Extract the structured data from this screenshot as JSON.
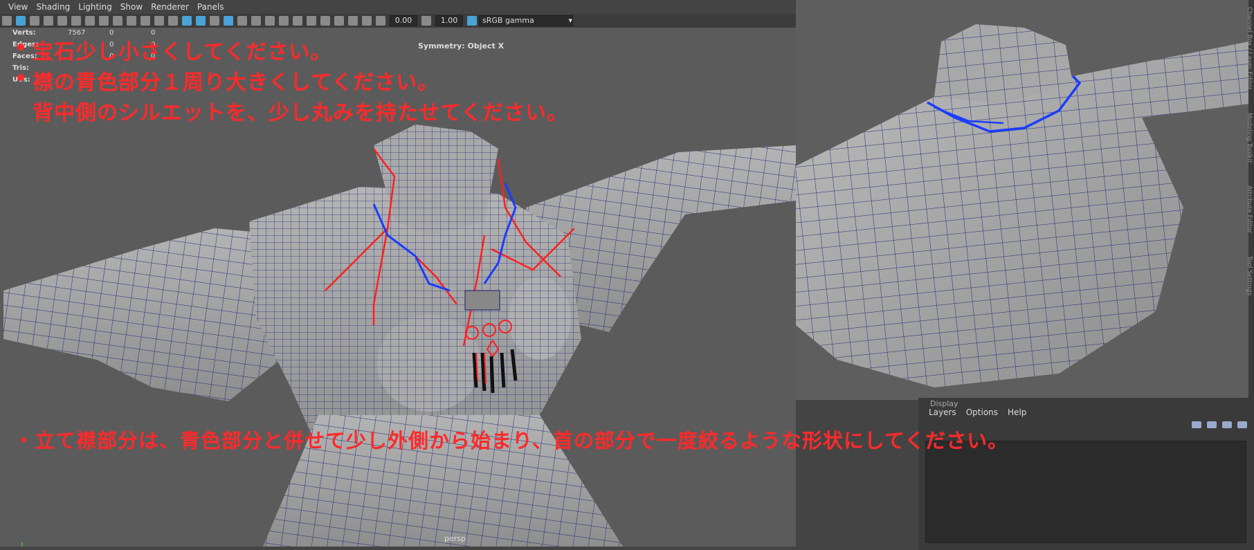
{
  "menubar": {
    "items": [
      "View",
      "Shading",
      "Lighting",
      "Show",
      "Renderer",
      "Panels"
    ]
  },
  "toolbar": {
    "exposure": "0.00",
    "gamma": "1.00",
    "color_space": "sRGB gamma"
  },
  "stats": {
    "rows": [
      {
        "label": "Verts:",
        "a": "7567",
        "b": "0",
        "c": "0"
      },
      {
        "label": "Edges:",
        "a": "",
        "b": "0",
        "c": "0"
      },
      {
        "label": "Faces:",
        "a": "",
        "b": "0",
        "c": "0"
      },
      {
        "label": "Tris:",
        "a": "",
        "b": "",
        "c": ""
      },
      {
        "label": "UVs:",
        "a": "",
        "b": "",
        "c": ""
      }
    ]
  },
  "symmetry": "Symmetry: Object X",
  "camera": "persp",
  "notes": {
    "line1": "宝石少し小さくしてください。",
    "line2": "襟の青色部分１周り大きくしてください。",
    "line3": "背中側のシルエットを、少し丸みを持たせてください。",
    "line4": "・立て襟部分は、青色部分と併せて少し外側から始まり、首の部分で一度絞るような形状にしてください。"
  },
  "layer_panel": {
    "header": "Display",
    "menu": [
      "Layers",
      "Options",
      "Help"
    ]
  },
  "side_tabs": [
    "Channel Box / Layer Editor",
    "Modeling Toolkit",
    "Attribute Editor",
    "Tool Settings"
  ]
}
